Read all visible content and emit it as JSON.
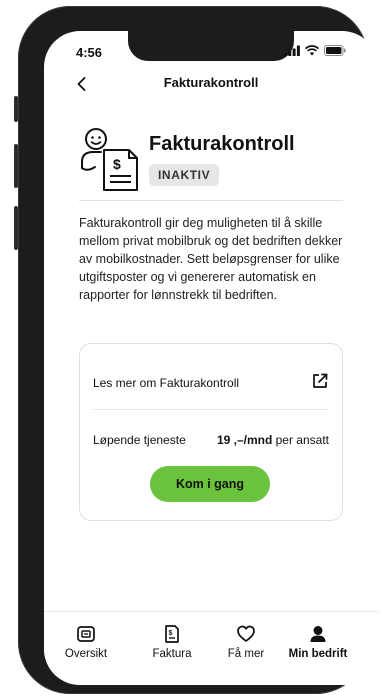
{
  "status_bar": {
    "time": "4:56"
  },
  "header": {
    "title": "Fakturakontroll"
  },
  "hero": {
    "title": "Fakturakontroll",
    "badge": "INAKTIV",
    "icon": "invoice-person-icon"
  },
  "description": "Fakturakontroll gir deg muligheten til å skille mellom privat mobilbruk og det bedriften dekker av mobilkostnader. Sett beløpsgrenser for ulike utgiftsposter og vi genererer automatisk en rapporter for lønnstrekk til bedriften.",
  "card": {
    "link_label": "Les mer om Fakturakontroll",
    "service_label": "Løpende tjeneste",
    "price_amount": "19 ,–/mnd",
    "price_suffix": " per ansatt",
    "cta_label": "Kom i gang"
  },
  "tabbar": {
    "items": [
      {
        "label": "Oversikt",
        "icon": "overview-icon"
      },
      {
        "label": "Faktura",
        "icon": "invoice-icon"
      },
      {
        "label": "Få mer",
        "icon": "heart-icon"
      },
      {
        "label": "Min bedrift",
        "icon": "person-icon",
        "active": true
      }
    ]
  },
  "colors": {
    "accent": "#6bc23c",
    "badge_bg": "#e6e6e6",
    "phone_frame": "#1c1c1e"
  }
}
